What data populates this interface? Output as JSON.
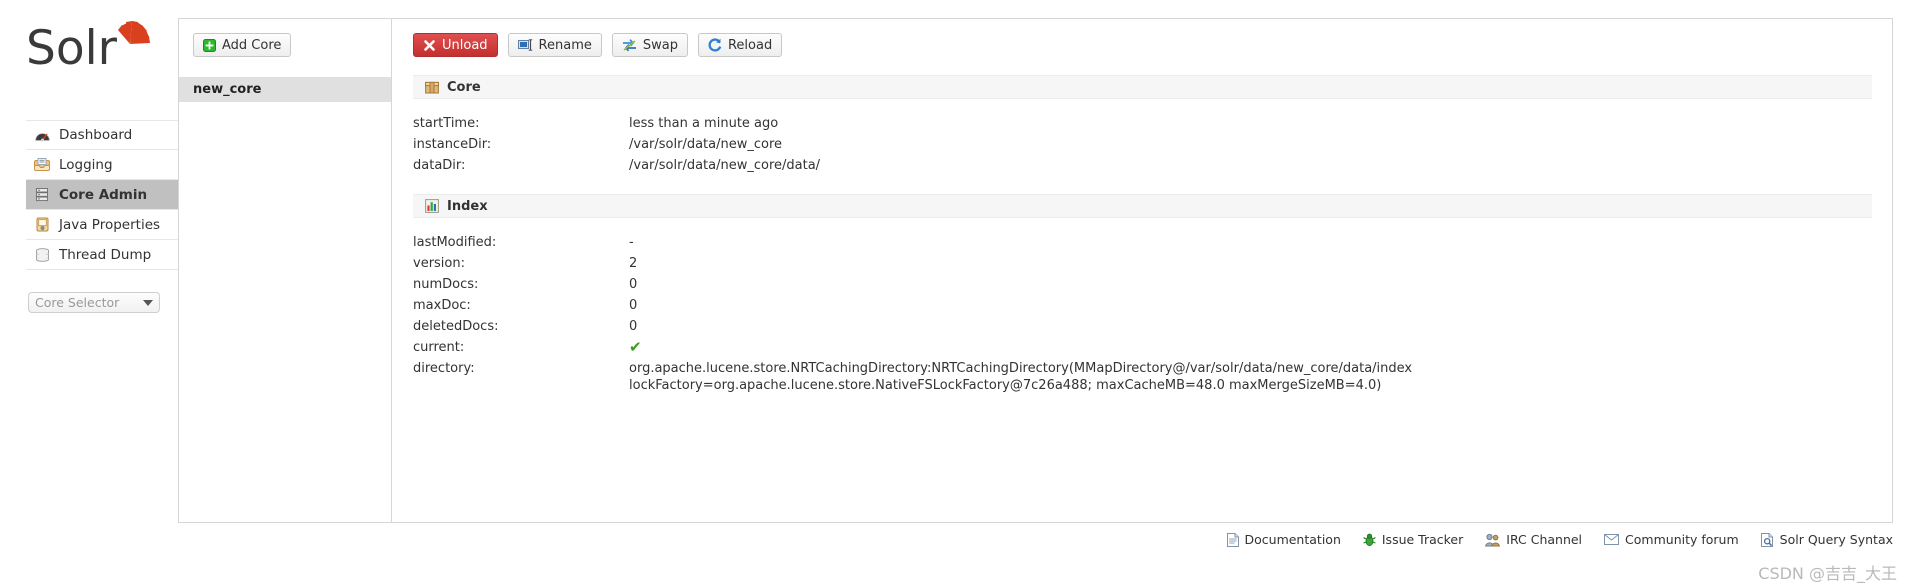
{
  "brand": {
    "name": "Solr",
    "logo_icon": "solr-logo"
  },
  "sidebar": {
    "items": [
      {
        "label": "Dashboard",
        "icon": "dashboard-gauge-icon",
        "active": false
      },
      {
        "label": "Logging",
        "icon": "logging-icon",
        "active": false
      },
      {
        "label": "Core Admin",
        "icon": "core-admin-icon",
        "active": true
      },
      {
        "label": "Java Properties",
        "icon": "java-properties-icon",
        "active": false
      },
      {
        "label": "Thread Dump",
        "icon": "thread-dump-icon",
        "active": false
      }
    ],
    "core_selector": {
      "placeholder": "Core Selector",
      "value": "Core Selector",
      "icon": "chevron-down-icon"
    }
  },
  "core_list": {
    "add_core_label": "Add Core",
    "add_core_icon": "plus-green-icon",
    "cores": [
      {
        "name": "new_core",
        "selected": true
      }
    ]
  },
  "actions": [
    {
      "label": "Unload",
      "icon": "unload-red-x-icon",
      "style": "danger"
    },
    {
      "label": "Rename",
      "icon": "rename-icon",
      "style": "default"
    },
    {
      "label": "Swap",
      "icon": "swap-icon",
      "style": "default"
    },
    {
      "label": "Reload",
      "icon": "reload-icon",
      "style": "default"
    }
  ],
  "sections": [
    {
      "title": "Core",
      "icon": "package-box-icon",
      "rows": [
        {
          "key": "startTime:",
          "value": "less than a minute ago"
        },
        {
          "key": "instanceDir:",
          "value": "/var/solr/data/new_core"
        },
        {
          "key": "dataDir:",
          "value": "/var/solr/data/new_core/data/"
        }
      ]
    },
    {
      "title": "Index",
      "icon": "bar-chart-icon",
      "rows": [
        {
          "key": "lastModified:",
          "value": "-"
        },
        {
          "key": "version:",
          "value": "2"
        },
        {
          "key": "numDocs:",
          "value": "0"
        },
        {
          "key": "maxDoc:",
          "value": "0"
        },
        {
          "key": "deletedDocs:",
          "value": "0"
        },
        {
          "key": "current:",
          "value": "✔",
          "is_check": true
        },
        {
          "key": "directory:",
          "value": "org.apache.lucene.store.NRTCachingDirectory:NRTCachingDirectory(MMapDirectory@/var/solr/data/new_core/data/index\nlockFactory=org.apache.lucene.store.NativeFSLockFactory@7c26a488; maxCacheMB=48.0 maxMergeSizeMB=4.0)"
        }
      ]
    }
  ],
  "footer": {
    "links": [
      {
        "label": "Documentation",
        "icon": "document-icon"
      },
      {
        "label": "Issue Tracker",
        "icon": "bug-icon"
      },
      {
        "label": "IRC Channel",
        "icon": "users-icon"
      },
      {
        "label": "Community forum",
        "icon": "mail-icon"
      },
      {
        "label": "Solr Query Syntax",
        "icon": "search-doc-icon"
      }
    ]
  },
  "watermark": {
    "text": "CSDN @吉吉_大王"
  },
  "colors": {
    "accent_red": "#d9411e",
    "danger": "#c42f2f",
    "active_nav": "#c0c0c0",
    "section_bg": "#f6f6f6",
    "check_green": "#3a9a1e"
  }
}
